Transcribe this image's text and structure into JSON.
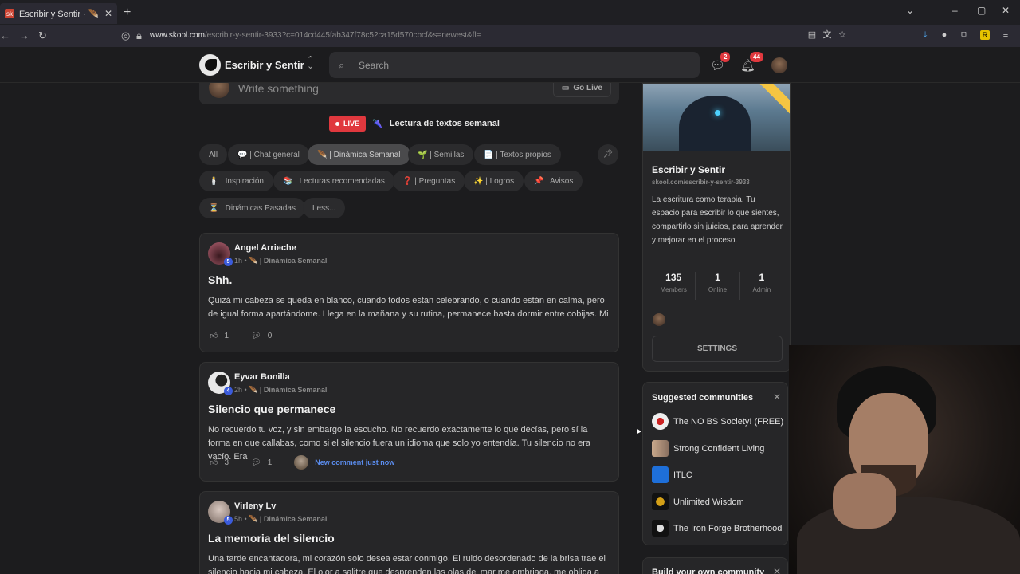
{
  "browser": {
    "tab_title": "Escribir y Sentir · 🪶 | Dinámica",
    "tab_favicon": "sk",
    "url_domain": "www.skool.com",
    "url_path": "/escribir-y-sentir-3933?c=014cd445fab347f78c52ca15d570cbcf&s=newest&fl="
  },
  "header": {
    "brand": "Escribir y Sentir",
    "search_placeholder": "Search",
    "chat_badge": "2",
    "notif_badge": "44"
  },
  "composer": {
    "placeholder": "Write something",
    "go_live": "Go Live"
  },
  "live": {
    "badge": "LIVE",
    "title": "Lectura de textos semanal",
    "icon": "🌂"
  },
  "categories": [
    {
      "label": "All"
    },
    {
      "label": "💬 | Chat general"
    },
    {
      "label": "🪶 | Dinámica Semanal"
    },
    {
      "label": "🌱 | Semillas"
    },
    {
      "label": "📄 | Textos propios"
    },
    {
      "label": "🕯️ | Inspiración"
    },
    {
      "label": "📚 | Lecturas recomendadas"
    },
    {
      "label": "❓ | Preguntas"
    },
    {
      "label": "✨ | Logros"
    },
    {
      "label": "📌 | Avisos"
    },
    {
      "label": "⏳ | Dinámicas Pasadas"
    },
    {
      "label": "Less..."
    }
  ],
  "posts": [
    {
      "author": "Angel Arrieche",
      "level": "5",
      "time": "1h",
      "category": "🪶 | Dinámica Semanal",
      "title": "Shh.",
      "body": "Quizá mi cabeza se queda en blanco, cuando todos están celebrando, o cuando están en calma, pero de igual forma apartándome. Llega en la mañana y su rutina, permanece hasta dormir entre cobijas. Mi",
      "likes": "1",
      "comments": "0"
    },
    {
      "author": "Eyvar Bonilla",
      "level": "4",
      "time": "2h",
      "category": "🪶 | Dinámica Semanal",
      "title": "Silencio que permanece",
      "body": "No recuerdo tu voz, y sin embargo la escucho. No recuerdo exactamente lo que decías, pero sí la forma en que callabas, como si el silencio fuera un idioma que solo yo entendía. Tu silencio no era vacío. Era",
      "likes": "3",
      "comments": "1",
      "new_comment": "New comment just now"
    },
    {
      "author": "Virleny Lv",
      "level": "5",
      "time": "5h",
      "category": "🪶 | Dinámica Semanal",
      "title": "La memoria del silencio",
      "body": "Una tarde encantadora, mi corazón solo desea estar conmigo. El ruido desordenado de la brisa trae el silencio hacia mi cabeza. El olor a salitre que desprenden las olas del mar me embriaga, me obliga a"
    }
  ],
  "community": {
    "name": "Escribir y Sentir",
    "url": "skool.com/escribir-y-sentir-3933",
    "description": "La escritura como terapia. Tu espacio para escribir lo que sientes, compartirlo sin juicios, para aprender y mejorar en el proceso.",
    "stats": [
      {
        "value": "135",
        "label": "Members"
      },
      {
        "value": "1",
        "label": "Online"
      },
      {
        "value": "1",
        "label": "Admin"
      }
    ],
    "settings": "SETTINGS"
  },
  "suggested": {
    "title": "Suggested communities",
    "items": [
      {
        "name": "The NO BS Society! (FREE)"
      },
      {
        "name": "Strong Confident Living"
      },
      {
        "name": "ITLC"
      },
      {
        "name": "Unlimited Wisdom"
      },
      {
        "name": "The Iron Forge Brotherhood"
      }
    ]
  },
  "build": {
    "title": "Build your own community"
  }
}
